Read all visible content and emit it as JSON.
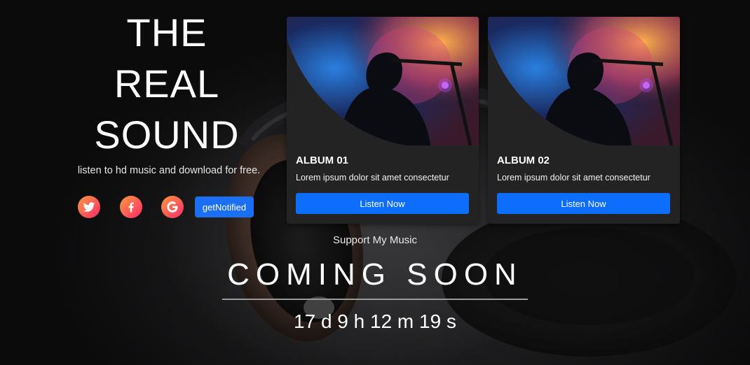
{
  "hero": {
    "title_lines": [
      "THE",
      "REAL",
      "SOUND"
    ],
    "tagline": "listen to hd music and download for free."
  },
  "social": {
    "icons": [
      "twitter-icon",
      "facebook-icon",
      "google-icon"
    ],
    "notify_label": "getNotified"
  },
  "albums": [
    {
      "title": "ALBUM 01",
      "description": "Lorem ipsum dolor sit amet consectetur",
      "button_label": "Listen Now"
    },
    {
      "title": "ALBUM 02",
      "description": "Lorem ipsum dolor sit amet consectetur",
      "button_label": "Listen Now"
    }
  ],
  "footer": {
    "support": "Support My Music",
    "coming_soon": "COMING SOON",
    "countdown": "17 d 9 h 12 m 19 s"
  },
  "colors": {
    "accent": "#0d6efd",
    "social_gradient_start": "#ff9a3c",
    "social_gradient_end": "#ff2a6b",
    "card_background": "#232323"
  }
}
